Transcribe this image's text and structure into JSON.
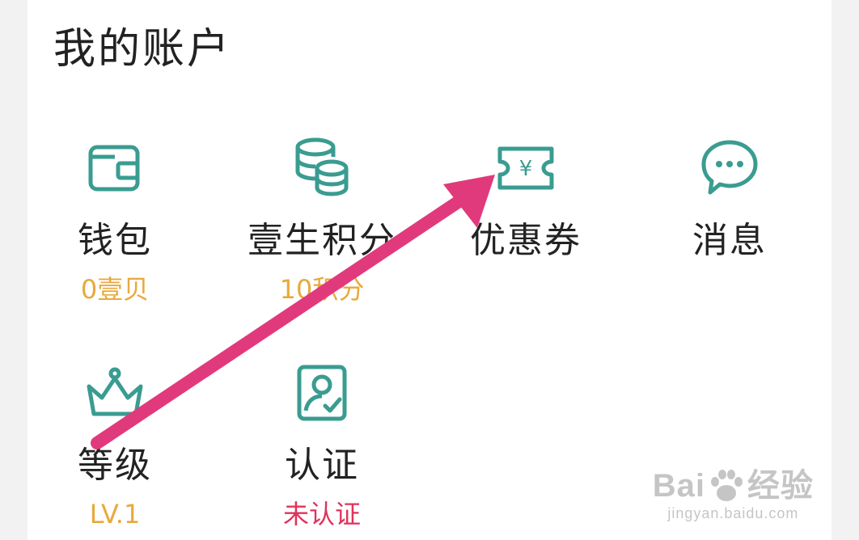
{
  "account": {
    "title": "我的账户",
    "items": [
      {
        "label": "钱包",
        "sub": "0壹贝",
        "icon": "wallet-icon"
      },
      {
        "label": "壹生积分",
        "sub": "10积分",
        "icon": "coins-icon"
      },
      {
        "label": "优惠券",
        "sub": "",
        "icon": "coupon-icon"
      },
      {
        "label": "消息",
        "sub": "",
        "icon": "message-icon"
      },
      {
        "label": "等级",
        "sub": "LV.1",
        "icon": "crown-icon"
      },
      {
        "label": "认证",
        "sub": "未认证",
        "icon": "verified-user-icon"
      }
    ]
  },
  "watermark": {
    "brand": "Bai",
    "brand_cn": "经验",
    "url": "jingyan.baidu.com"
  },
  "colors": {
    "icon": "#3a9c91",
    "sub_text": "#e8a93c",
    "warning_text": "#e0325a",
    "arrow": "#e03a7c"
  }
}
